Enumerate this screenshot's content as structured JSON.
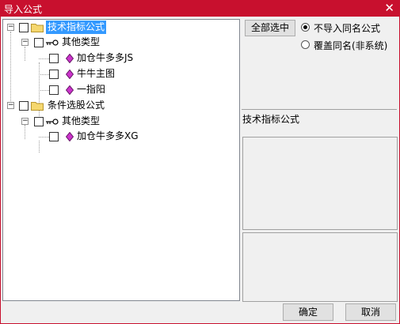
{
  "window": {
    "title": "导入公式",
    "close_glyph": "✕"
  },
  "tree": {
    "nodes": [
      {
        "label": "技术指标公式",
        "selected": true
      },
      {
        "label": "其他类型"
      },
      {
        "label": "加仓牛多多JS"
      },
      {
        "label": "牛牛主图"
      },
      {
        "label": "一指阳"
      },
      {
        "label": "条件选股公式"
      },
      {
        "label": "其他类型"
      },
      {
        "label": "加仓牛多多XG"
      }
    ],
    "expander_glyph": "−"
  },
  "options": {
    "select_all_label": "全部选中",
    "radio_skip_label": "不导入同名公式",
    "radio_overwrite_label": "覆盖同名(非系统)",
    "selected_radio": "skip"
  },
  "info": {
    "category_label": "技术指标公式"
  },
  "buttons": {
    "ok_label": "确定",
    "cancel_label": "取消"
  },
  "colors": {
    "titlebar": "#c8102e",
    "selection": "#3399ff",
    "folder": "#f5d76e",
    "gem": "#cc33cc"
  }
}
